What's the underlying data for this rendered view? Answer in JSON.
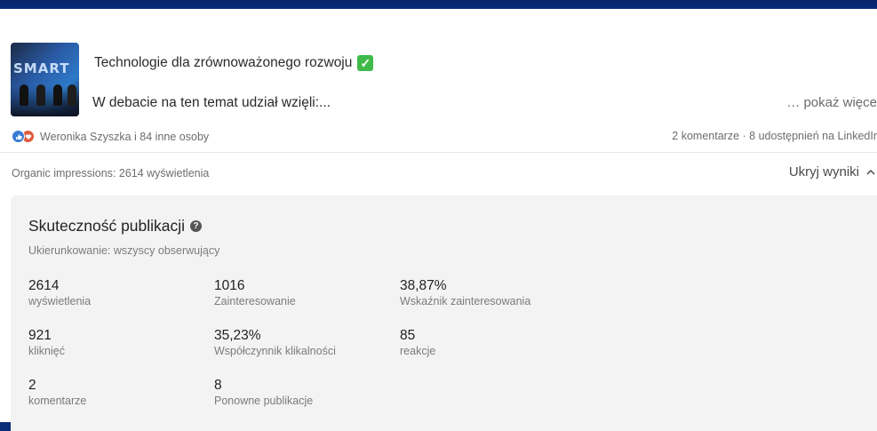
{
  "post": {
    "thumbnail_text": "SMART",
    "title": "Technologie dla zrównoważonego rozwoju",
    "title_emoji": "✓",
    "excerpt": "W debacie na ten temat udział wzięli:...",
    "show_more": "… pokaż więce",
    "reactions_text": "Weronika Szyszka i 84 inne osoby",
    "engagement_text": "2 komentarze · 8 udostępnień na LinkedIr",
    "impressions_text": "Organic impressions: 2614 wyświetlenia",
    "hide_results": "Ukryj wyniki"
  },
  "performance": {
    "title": "Skuteczność publikacji",
    "subtitle": "Ukierunkowanie: wszyscy obserwujący",
    "metrics": [
      {
        "value": "2614",
        "label": "wyświetlenia"
      },
      {
        "value": "1016",
        "label": "Zainteresowanie"
      },
      {
        "value": "38,87%",
        "label": "Wskaźnik zainteresowania"
      },
      {
        "value": "921",
        "label": "kliknięć"
      },
      {
        "value": "35,23%",
        "label": "Współczynnik klikalności"
      },
      {
        "value": "85",
        "label": "reakcje"
      },
      {
        "value": "2",
        "label": "komentarze"
      },
      {
        "value": "8",
        "label": "Ponowne publikacje"
      }
    ]
  },
  "colors": {
    "frame": "#0f3385",
    "like": "#3a7bd5",
    "love": "#e0593b",
    "check": "#3fba4b"
  },
  "icons": [
    "like-reaction-icon",
    "love-reaction-icon",
    "check-emoji-icon",
    "help-icon",
    "chevron-up-icon"
  ]
}
